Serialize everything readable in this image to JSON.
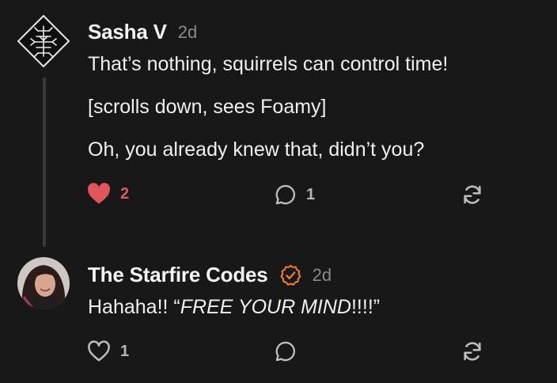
{
  "comments": [
    {
      "author": "Sasha V",
      "time": "2d",
      "paragraphs": [
        "That’s nothing, squirrels can control time!",
        "[scrolls down, sees Foamy]",
        "Oh, you already knew that, didn’t you?"
      ],
      "likes": "2",
      "liked": true,
      "replies": "1",
      "avatar_icon": "rune-diamond-icon"
    },
    {
      "author": "The Starfire Codes",
      "verified": true,
      "time": "2d",
      "body_prefix": "Hahaha!! “",
      "body_italic": "FREE YOUR MIND",
      "body_suffix": "!!!!”",
      "likes": "1",
      "liked": false,
      "replies": "",
      "avatar_icon": "user-photo-avatar"
    }
  ],
  "colors": {
    "background": "#181818",
    "like_active": "#e0565a",
    "verified_badge": "#f07a2a",
    "icon_gray": "#bdbdbd"
  }
}
